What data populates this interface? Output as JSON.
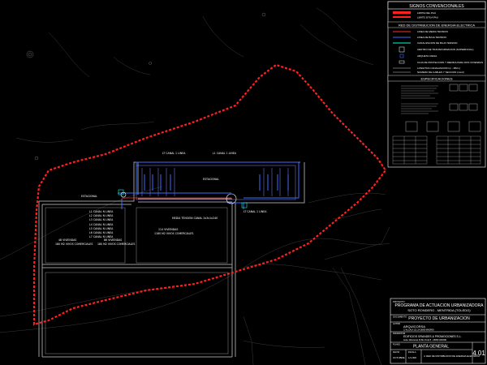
{
  "legend": {
    "title": "SIGNOS CONVENCIONALES",
    "items": [
      {
        "label": "LIMITE DEL PAU",
        "symbol": "red-dash"
      },
      {
        "label": "LIMITE SITUA PAU",
        "symbol": "red-dash-thin"
      }
    ],
    "section_title": "RED DE DISTRIBUCION DE ENERGIA ELECTRICA",
    "red_items": [
      {
        "label": "LINEA DE MEDIA TENSION",
        "symbol": "red-line"
      },
      {
        "label": "LINEA DE BAJA TENSION",
        "symbol": "blue-line"
      },
      {
        "label": "CANALIZACION DE BAJA TENSION",
        "symbol": "cyan-line"
      },
      {
        "label": "CENTRO DE TRANSFORMACION (SUPERFICIAL)",
        "symbol": "box"
      },
      {
        "label": "ARQUETA CIEGA",
        "symbol": "square"
      },
      {
        "label": "CAJA DE PROTECCION Y MEDIDA PARA DOS VIVIENDAS",
        "symbol": "small-box"
      },
      {
        "label": "LONGITUD CANALIZACION (n - MM L)",
        "symbol": "text"
      },
      {
        "label": "NUMERO DE CABLES Y SECCION (mm2)",
        "symbol": "text"
      }
    ],
    "specs_title": "ESPECIFICACIONES"
  },
  "plan": {
    "labels": {
      "label_l1": "L1  CANAL N LINEA",
      "label_l2": "L2  CANAL N LINEA",
      "label_l3": "L3  CANAL N LINEA",
      "label_l4": "L4  CANAL N LINEA",
      "label_l5": "L5  CANAL N LINEA",
      "label_l6": "L6  CANAL N LINEA",
      "label_l7": "L7  CANAL N LINEA",
      "top_a": "LT  CANAL 1 LINEA",
      "top_b": "L1  CANAL 1 LINEA",
      "estacional": "ESTACIONAL",
      "estacional2": "ESTACIONAL",
      "viviendas_a": "86 VIVIENDAS",
      "viviendas_a2": "180 M2 VIVOS COMERCIALES",
      "viviendas_b": "48 VIVIENDAS",
      "viviendas_b2": "180 M2 VIVOS COMERCIALES",
      "viviendas_c": "114 VIVIENDAS",
      "viviendas_c2": "1180 M2 VIVOS COMERCIALES",
      "mt_label": "MEDIA TENSION  CANAL 2x3x1x240",
      "ct_label": "LT  CANAL 1 LINEA"
    }
  },
  "titleblock": {
    "block1_label": "PROYECTO",
    "project": "PROGRAMA DE ACTUACION URBANIZADORA",
    "location": "SOTO RONDERO - MENTRIDA (TOLEDO)",
    "block2_label": "DOCUMENTO",
    "document": "PROYECTO DE URBANIZACION",
    "author_label": "AUTOR",
    "author": "ARQUICORSA",
    "author_sub": "C/ ALCALA 121  2A  28009 MADRID",
    "promoter_label": "PROMOTOR",
    "promoter": "EDIFICIOS GRANDES & PROMOCIONES S.L.",
    "promoter_sub": "Avda. Manoteras 46 Bis Portal 5 - 28050 MADRID",
    "plan_label": "PLANO",
    "plan": "PLANTA GENERAL",
    "sheet": "4.01",
    "scale_label": "ESCALA",
    "scale": "1/1.000",
    "date_label": "FECHA",
    "date": "OCTUBRE",
    "plan_title2": "4. RED DE DISTRIBUCION DE ENERGIA ELECTRICA"
  }
}
